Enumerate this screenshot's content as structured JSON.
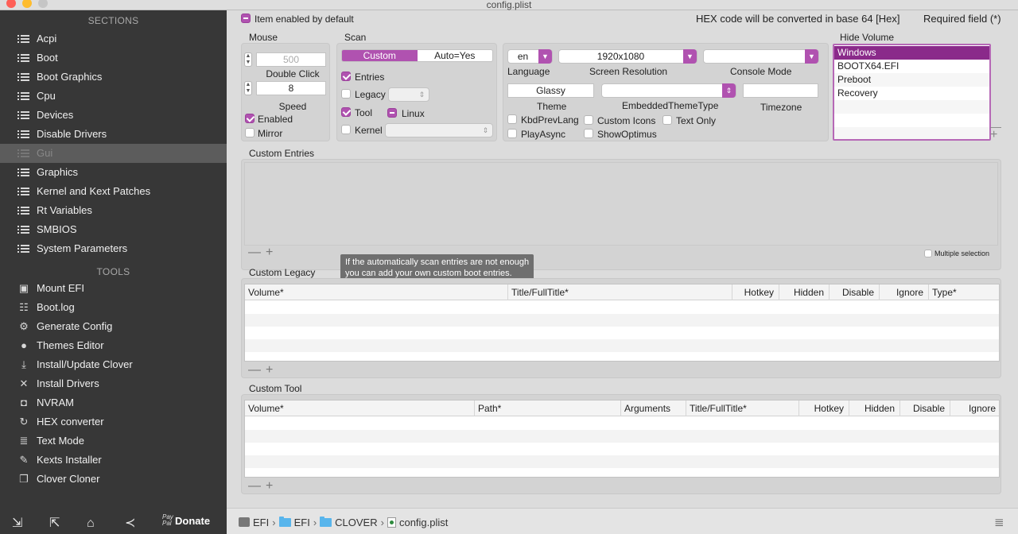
{
  "window": {
    "title": "config.plist"
  },
  "sidebar": {
    "sections_title": "SECTIONS",
    "sections": [
      {
        "label": "Acpi",
        "icon": "list-icon"
      },
      {
        "label": "Boot",
        "icon": "list-icon"
      },
      {
        "label": "Boot Graphics",
        "icon": "list-icon"
      },
      {
        "label": "Cpu",
        "icon": "list-icon"
      },
      {
        "label": "Devices",
        "icon": "list-icon"
      },
      {
        "label": "Disable Drivers",
        "icon": "list-icon"
      },
      {
        "label": "Gui",
        "icon": "list-icon",
        "selected": true
      },
      {
        "label": "Graphics",
        "icon": "list-icon"
      },
      {
        "label": "Kernel and Kext Patches",
        "icon": "list-icon"
      },
      {
        "label": "Rt Variables",
        "icon": "list-icon"
      },
      {
        "label": "SMBIOS",
        "icon": "list-icon"
      },
      {
        "label": "System Parameters",
        "icon": "list-icon"
      }
    ],
    "tools_title": "TOOLS",
    "tools": [
      {
        "label": "Mount EFI",
        "icon": "disk-icon"
      },
      {
        "label": "Boot.log",
        "icon": "log-icon"
      },
      {
        "label": "Generate Config",
        "icon": "gears-icon"
      },
      {
        "label": "Themes Editor",
        "icon": "palette-icon"
      },
      {
        "label": "Install/Update Clover",
        "icon": "download-icon"
      },
      {
        "label": "Install Drivers",
        "icon": "tools-icon"
      },
      {
        "label": "NVRAM",
        "icon": "chip-icon"
      },
      {
        "label": "HEX converter",
        "icon": "refresh-icon"
      },
      {
        "label": "Text Mode",
        "icon": "text-icon"
      },
      {
        "label": "Kexts Installer",
        "icon": "wrench-icon"
      },
      {
        "label": "Clover Cloner",
        "icon": "clone-icon"
      }
    ],
    "bottom": {
      "donate_label": "Donate",
      "paypal_mark": "Pay Pal"
    }
  },
  "header": {
    "item_enabled_label": "Item enabled by default",
    "hex_note": "HEX code will be converted in base 64 [Hex]",
    "required_note": "Required field (*)"
  },
  "mouse": {
    "title": "Mouse",
    "double_click_value": "500",
    "double_click_label": "Double Click",
    "speed_value": "8",
    "speed_label": "Speed",
    "enabled_label": "Enabled",
    "mirror_label": "Mirror"
  },
  "scan": {
    "title": "Scan",
    "segments": [
      "Custom",
      "Auto=Yes"
    ],
    "entries_label": "Entries",
    "legacy_label": "Legacy",
    "tool_label": "Tool",
    "linux_label": "Linux",
    "kernel_label": "Kernel"
  },
  "gui": {
    "language_value": "en",
    "language_label": "Language",
    "resolution_value": "1920x1080",
    "resolution_label": "Screen Resolution",
    "console_mode_value": "",
    "console_mode_label": "Console Mode",
    "theme_value": "Glassy",
    "theme_label": "Theme",
    "embedded_theme_label": "EmbeddedThemeType",
    "timezone_label": "Timezone",
    "kbd_label": "KbdPrevLang",
    "custom_icons_label": "Custom Icons",
    "text_only_label": "Text Only",
    "play_async_label": "PlayAsync",
    "show_optimus_label": "ShowOptimus"
  },
  "hide_volume": {
    "title": "Hide Volume",
    "items": [
      "Windows",
      "BOOTX64.EFI",
      "Preboot",
      "Recovery"
    ]
  },
  "custom_entries": {
    "title": "Custom Entries",
    "multiple_selection_label": "Multiple selection"
  },
  "tooltip": {
    "line1": "If the automatically scan entries are not enough",
    "line2": "you can add your own custom boot entries."
  },
  "custom_legacy": {
    "title": "Custom Legacy",
    "columns": [
      "Volume*",
      "Title/FullTitle*",
      "Hotkey",
      "Hidden",
      "Disable",
      "Ignore",
      "Type*"
    ]
  },
  "custom_tool": {
    "title": "Custom Tool",
    "columns": [
      "Volume*",
      "Path*",
      "Arguments",
      "Title/FullTitle*",
      "Hotkey",
      "Hidden",
      "Disable",
      "Ignore"
    ]
  },
  "pathbar": {
    "crumbs": [
      "EFI",
      "EFI",
      "CLOVER",
      "config.plist"
    ]
  },
  "colors": {
    "accent": "#b052b0",
    "selection": "#8a2a8a",
    "sidebar_bg": "#373737"
  }
}
